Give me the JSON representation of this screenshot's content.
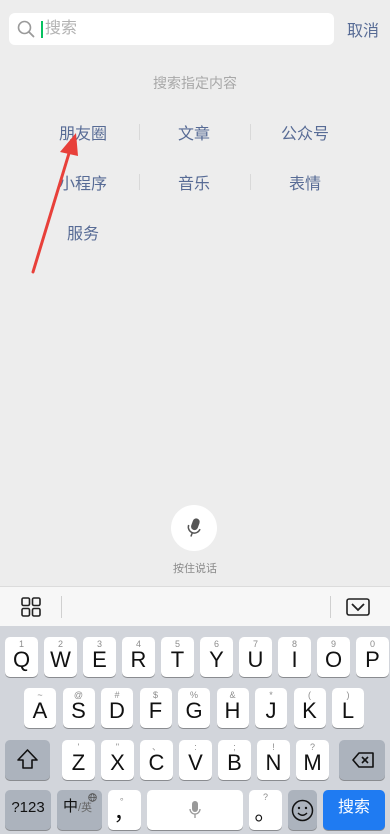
{
  "search": {
    "placeholder": "搜索",
    "cancel_label": "取消"
  },
  "hint": "搜索指定内容",
  "categories": [
    [
      "朋友圈",
      "文章",
      "公众号"
    ],
    [
      "小程序",
      "音乐",
      "表情"
    ],
    [
      "服务"
    ]
  ],
  "voice": {
    "label": "按住说话"
  },
  "keyboard": {
    "row1": [
      {
        "main": "Q",
        "sub": "1"
      },
      {
        "main": "W",
        "sub": "2"
      },
      {
        "main": "E",
        "sub": "3"
      },
      {
        "main": "R",
        "sub": "4"
      },
      {
        "main": "T",
        "sub": "5"
      },
      {
        "main": "Y",
        "sub": "6"
      },
      {
        "main": "U",
        "sub": "7"
      },
      {
        "main": "I",
        "sub": "8"
      },
      {
        "main": "O",
        "sub": "9"
      },
      {
        "main": "P",
        "sub": "0"
      }
    ],
    "row2": [
      {
        "main": "A",
        "sub": "~"
      },
      {
        "main": "S",
        "sub": "@"
      },
      {
        "main": "D",
        "sub": "#"
      },
      {
        "main": "F",
        "sub": "$"
      },
      {
        "main": "G",
        "sub": "%"
      },
      {
        "main": "H",
        "sub": "&"
      },
      {
        "main": "J",
        "sub": "*"
      },
      {
        "main": "K",
        "sub": "("
      },
      {
        "main": "L",
        "sub": ")"
      }
    ],
    "row3": [
      {
        "main": "Z",
        "sub": "'"
      },
      {
        "main": "X",
        "sub": "\""
      },
      {
        "main": "C",
        "sub": "、"
      },
      {
        "main": "V",
        "sub": ":"
      },
      {
        "main": "B",
        "sub": ";"
      },
      {
        "main": "N",
        "sub": "!"
      },
      {
        "main": "M",
        "sub": "?"
      }
    ],
    "numbers_label": "?123",
    "lang_main": "中",
    "lang_sub": "/英",
    "comma_main": "，",
    "comma_sub": "。",
    "question_sub": "?",
    "question_main": "。",
    "search_label": "搜索"
  },
  "colors": {
    "accent": "#07c160",
    "link": "#576b95",
    "annotation": "#e8403a",
    "keyboard_action": "#1f7bf2"
  }
}
